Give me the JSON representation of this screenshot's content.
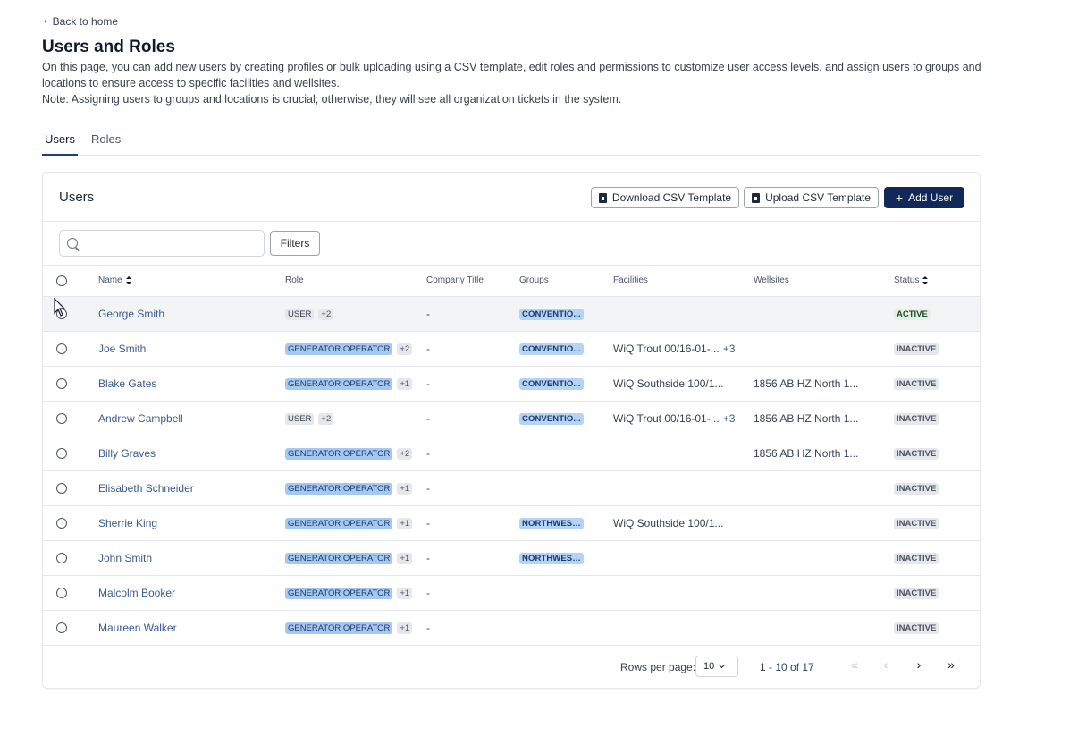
{
  "nav": {
    "back_label": "Back to home"
  },
  "page": {
    "title": "Users and Roles",
    "description_1": "On this page, you can add new users by creating profiles or bulk uploading using a CSV template, edit roles and permissions to customize user access levels, and assign users to groups and locations to ensure access to specific facilities and wellsites.",
    "description_2": "Note: Assigning users to groups and locations is crucial; otherwise, they will see all organization tickets in the system."
  },
  "tabs": [
    {
      "label": "Users",
      "active": true
    },
    {
      "label": "Roles",
      "active": false
    }
  ],
  "card": {
    "title": "Users",
    "download_label": "Download CSV Template",
    "upload_label": "Upload CSV Template",
    "add_label": "Add User",
    "filters_label": "Filters",
    "search_placeholder": ""
  },
  "table": {
    "columns": [
      "Name",
      "Role",
      "Company Title",
      "Groups",
      "Facilities",
      "Wellsites",
      "Status"
    ],
    "rows": [
      {
        "name": "George Smith",
        "role": "USER",
        "role_more": "+2",
        "title": "-",
        "group": "CONVENTIO...",
        "facility": "",
        "facility_more": "",
        "wellsite": "",
        "status": "ACTIVE"
      },
      {
        "name": "Joe Smith",
        "role": "GENERATOR OPERATOR",
        "role_more": "+2",
        "title": "-",
        "group": "CONVENTIO...",
        "facility": "WiQ Trout 00/16-01-...",
        "facility_more": "+3",
        "wellsite": "",
        "status": "INACTIVE"
      },
      {
        "name": "Blake Gates",
        "role": "GENERATOR OPERATOR",
        "role_more": "+1",
        "title": "-",
        "group": "CONVENTIO...",
        "facility": "WiQ Southside 100/1...",
        "facility_more": "",
        "wellsite": "1856 AB HZ North 1...",
        "status": "INACTIVE"
      },
      {
        "name": "Andrew Campbell",
        "role": "USER",
        "role_more": "+2",
        "title": "-",
        "group": "CONVENTIO...",
        "facility": "WiQ Trout 00/16-01-...",
        "facility_more": "+3",
        "wellsite": "1856 AB HZ North 1...",
        "status": "INACTIVE"
      },
      {
        "name": "Billy Graves",
        "role": "GENERATOR OPERATOR",
        "role_more": "+2",
        "title": "-",
        "group": "",
        "facility": "",
        "facility_more": "",
        "wellsite": "1856 AB HZ North 1...",
        "status": "INACTIVE"
      },
      {
        "name": "Elisabeth Schneider",
        "role": "GENERATOR OPERATOR",
        "role_more": "+1",
        "title": "-",
        "group": "",
        "facility": "",
        "facility_more": "",
        "wellsite": "",
        "status": "INACTIVE"
      },
      {
        "name": "Sherrie King",
        "role": "GENERATOR OPERATOR",
        "role_more": "+1",
        "title": "-",
        "group": "NORTHWEST...",
        "facility": "WiQ Southside 100/1...",
        "facility_more": "",
        "wellsite": "",
        "status": "INACTIVE"
      },
      {
        "name": "John Smith",
        "role": "GENERATOR OPERATOR",
        "role_more": "+1",
        "title": "-",
        "group": "NORTHWEST...",
        "facility": "",
        "facility_more": "",
        "wellsite": "",
        "status": "INACTIVE"
      },
      {
        "name": "Malcolm Booker",
        "role": "GENERATOR OPERATOR",
        "role_more": "+1",
        "title": "-",
        "group": "",
        "facility": "",
        "facility_more": "",
        "wellsite": "",
        "status": "INACTIVE"
      },
      {
        "name": "Maureen Walker",
        "role": "GENERATOR OPERATOR",
        "role_more": "+1",
        "title": "-",
        "group": "",
        "facility": "",
        "facility_more": "",
        "wellsite": "",
        "status": "INACTIVE"
      }
    ]
  },
  "pagination": {
    "rows_label": "Rows per page:",
    "rows_value": "10",
    "range": "1 - 10 of 17"
  },
  "colors": {
    "primary": "#12285a",
    "link": "#3b5a8f",
    "role_badge": "#a5c8f0",
    "group_badge": "#b5d4f5"
  },
  "icons": {
    "back": "chevron-left-icon",
    "search": "search-icon",
    "file": "file-icon",
    "add": "plus-icon",
    "sort": "sort-icon",
    "first": "chevrons-left-icon",
    "prev": "chevron-left-icon",
    "next": "chevron-right-icon",
    "last": "chevrons-right-icon"
  }
}
